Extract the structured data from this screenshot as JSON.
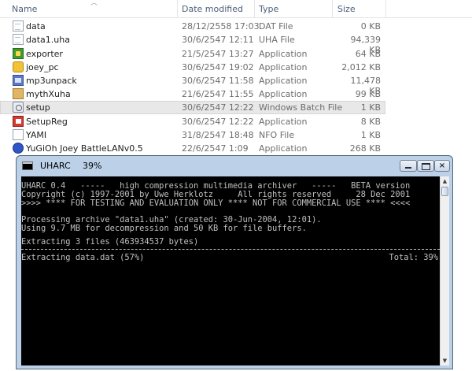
{
  "explorer": {
    "columns": {
      "name": "Name",
      "date": "Date modified",
      "type": "Type",
      "size": "Size"
    },
    "files": [
      {
        "name": "data",
        "date": "28/12/2558 17:03",
        "type": "DAT File",
        "size": "0 KB",
        "icon": "file-icon"
      },
      {
        "name": "data1.uha",
        "date": "30/6/2547 12:11",
        "type": "UHA File",
        "size": "94,339 KB",
        "icon": "file-icon"
      },
      {
        "name": "exporter",
        "date": "21/5/2547 13:27",
        "type": "Application",
        "size": "64 KB",
        "icon": "exporter-app-icon"
      },
      {
        "name": "joey_pc",
        "date": "30/6/2547 19:02",
        "type": "Application",
        "size": "2,012 KB",
        "icon": "joey-app-icon"
      },
      {
        "name": "mp3unpack",
        "date": "30/6/2547 11:58",
        "type": "Application",
        "size": "11,478 KB",
        "icon": "mp3unpack-app-icon"
      },
      {
        "name": "mythXuha",
        "date": "21/6/2547 11:55",
        "type": "Application",
        "size": "99 KB",
        "icon": "mythxuha-app-icon"
      },
      {
        "name": "setup",
        "date": "30/6/2547 12:22",
        "type": "Windows Batch File",
        "size": "1 KB",
        "icon": "batch-file-icon",
        "selected": true
      },
      {
        "name": "SetupReg",
        "date": "30/6/2547 12:22",
        "type": "Application",
        "size": "8 KB",
        "icon": "setupreg-app-icon"
      },
      {
        "name": "YAMI",
        "date": "31/8/2547 18:48",
        "type": "NFO File",
        "size": "1 KB",
        "icon": "nfo-file-icon"
      },
      {
        "name": "YuGiOh Joey BattleLANv0.5",
        "date": "22/6/2547 1:09",
        "type": "Application",
        "size": "268 KB",
        "icon": "yugioh-app-icon"
      }
    ]
  },
  "console": {
    "title": "UHARC",
    "progress": "39%",
    "lines": [
      "UHARC 0.4   -----   high compression multimedia archiver   -----   BETA version",
      "Copyright (c) 1997-2001 by Uwe Herklotz     All rights reserved     28 Dec 2001",
      ">>>> **** FOR TESTING AND EVALUATION ONLY **** NOT FOR COMMERCIAL USE **** <<<<",
      "",
      "Processing archive \"data1.uha\" (created: 30-Jun-2004, 12:01).",
      "Using 9.7 MB for decompression and 50 KB for file buffers.",
      "",
      "Extracting 3 files (463934537 bytes)"
    ],
    "status_left": "Extracting data.dat (57%)",
    "status_right": "Total: 39%"
  }
}
